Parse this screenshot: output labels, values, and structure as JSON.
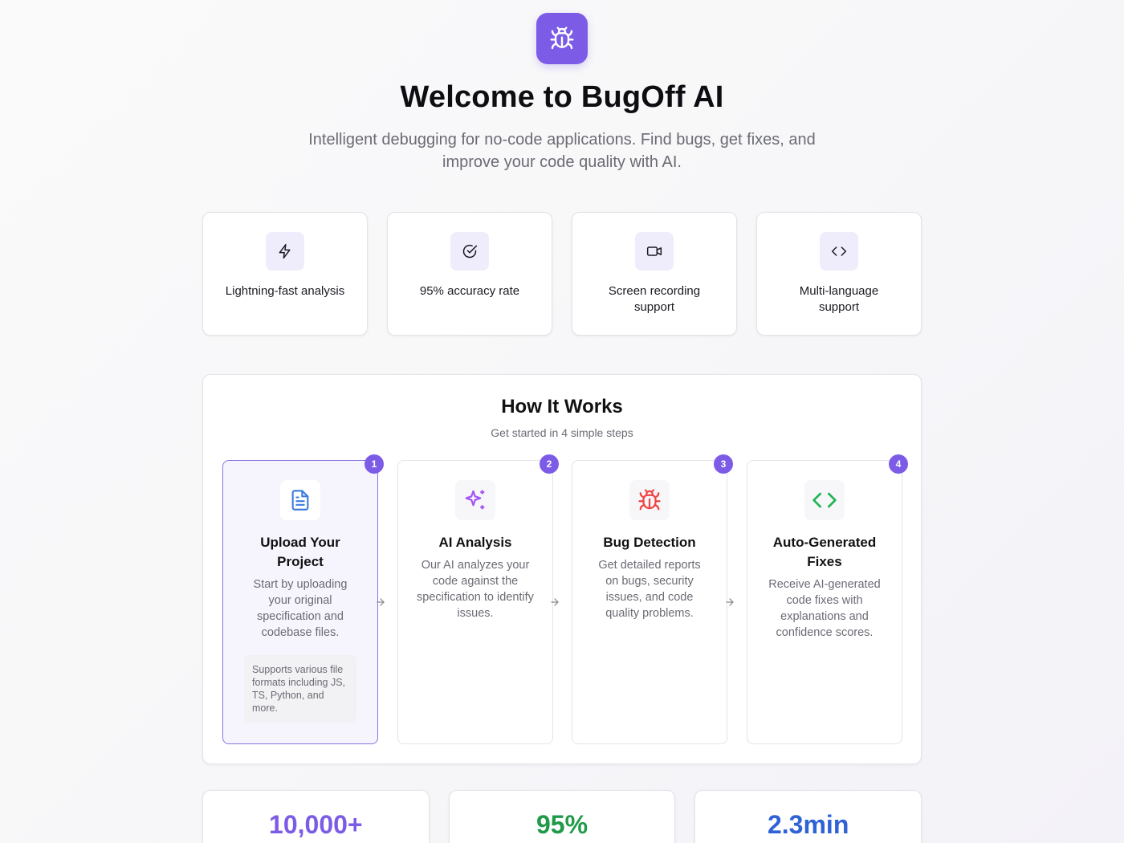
{
  "hero": {
    "logo_icon": "bug-icon",
    "title": "Welcome to BugOff AI",
    "subtitle": "Intelligent debugging for no-code applications. Find bugs, get fixes, and improve your code quality with AI."
  },
  "features": [
    {
      "icon": "lightning-icon",
      "label": "Lightning-fast analysis"
    },
    {
      "icon": "check-circle-icon",
      "label": "95% accuracy rate"
    },
    {
      "icon": "video-icon",
      "label": "Screen recording support"
    },
    {
      "icon": "code-icon",
      "label": "Multi-language support"
    }
  ],
  "how_it_works": {
    "title": "How It Works",
    "subtitle": "Get started in 4 simple steps",
    "steps": [
      {
        "number": "1",
        "icon": "file-text-icon",
        "icon_color": "#3b7be0",
        "title": "Upload Your Project",
        "description": "Start by uploading your original specification and codebase files.",
        "note": "Supports various file formats including JS, TS, Python, and more.",
        "active": true
      },
      {
        "number": "2",
        "icon": "sparkles-icon",
        "icon_color": "#a855f7",
        "title": "AI Analysis",
        "description": "Our AI analyzes your code against the specification to identify issues."
      },
      {
        "number": "3",
        "icon": "bug-icon",
        "icon_color": "#ef4444",
        "title": "Bug Detection",
        "description": "Get detailed reports on bugs, security issues, and code quality problems."
      },
      {
        "number": "4",
        "icon": "code-icon",
        "icon_color": "#22b455",
        "title": "Auto-Generated Fixes",
        "description": "Receive AI-generated code fixes with explanations and confidence scores."
      }
    ]
  },
  "stats": [
    {
      "value": "10,000+",
      "color": "#7c5ce6"
    },
    {
      "value": "95%",
      "color": "#1f9a48"
    },
    {
      "value": "2.3min",
      "color": "#2f62d6"
    }
  ],
  "colors": {
    "accent": "#7c5ce6"
  }
}
